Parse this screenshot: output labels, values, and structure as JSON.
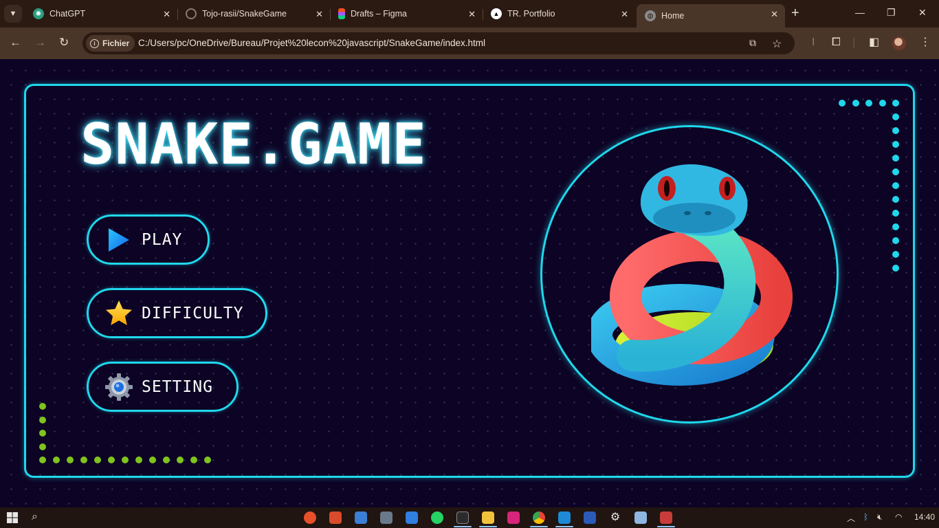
{
  "browser": {
    "tabs": [
      {
        "title": "ChatGPT",
        "icon": "chatgpt-icon"
      },
      {
        "title": "Tojo-rasii/SnakeGame",
        "icon": "github-icon"
      },
      {
        "title": "Drafts – Figma",
        "icon": "figma-icon"
      },
      {
        "title": "TR. Portfolio",
        "icon": "vercel-icon"
      },
      {
        "title": "Home",
        "icon": "globe-icon",
        "active": true
      }
    ],
    "security_chip": "Fichier",
    "url": "C:/Users/pc/OneDrive/Bureau/Projet%20lecon%20javascript/SnakeGame/index.html"
  },
  "game": {
    "title": "SNAKE.GAME",
    "menu": [
      {
        "label": "PLAY",
        "icon": "play-icon"
      },
      {
        "label": "DIFFICULTY",
        "icon": "star-icon"
      },
      {
        "label": "SETTING",
        "icon": "gear-icon"
      }
    ],
    "hero_image": "coiled-snake-illustration",
    "colors": {
      "accent": "#1fd8ec",
      "background": "#0d0324",
      "green_dots": "#7fc41e"
    }
  },
  "taskbar": {
    "clock": "14:40"
  }
}
